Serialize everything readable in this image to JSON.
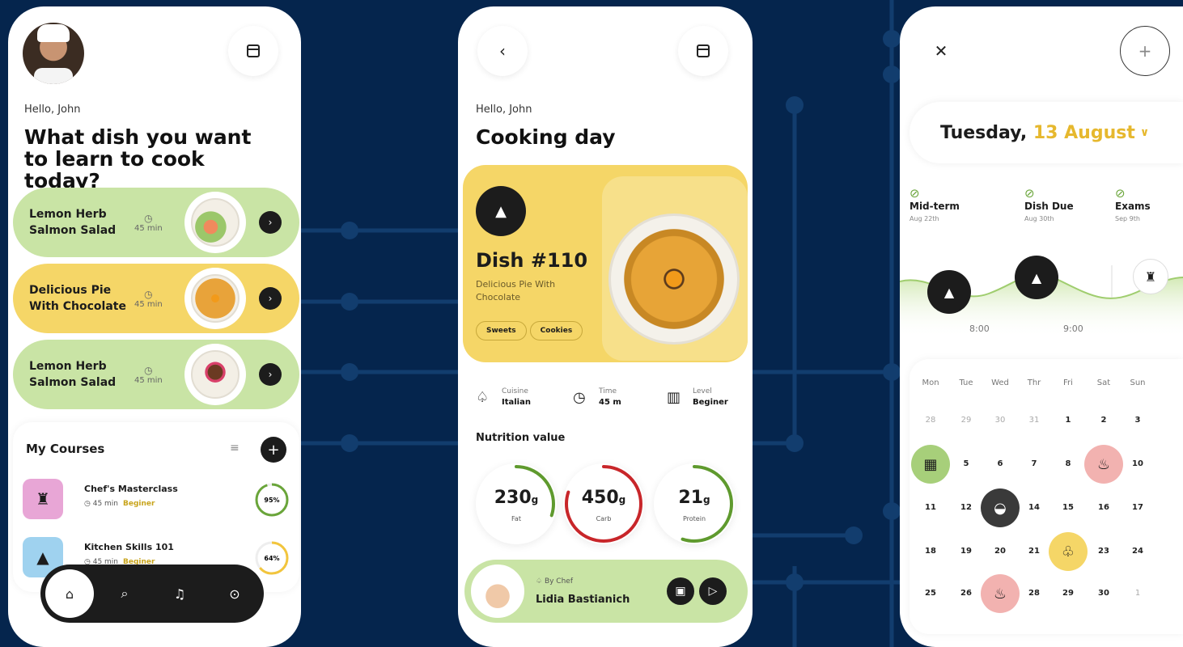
{
  "colors": {
    "background": "#05254d",
    "green": "#c9e4a5",
    "yellow": "#f5d667",
    "pink": "#f2b2b0",
    "dark": "#1c1c1c",
    "accent_text": "#c8a41c"
  },
  "screen1": {
    "greeting": "Hello, John",
    "headline": "What dish you want to learn to cook today?",
    "dishes": [
      {
        "name": "Lemon Herb Salmon Salad",
        "time": "45 min",
        "color": "green"
      },
      {
        "name": "Delicious Pie With Chocolate",
        "time": "45 min",
        "color": "yellow"
      },
      {
        "name": "Lemon Herb Salmon Salad",
        "time": "45 min",
        "color": "green"
      }
    ],
    "courses": {
      "title": "My Courses",
      "items": [
        {
          "title": "Chef's Masterclass",
          "time": "45 min",
          "level": "Beginer",
          "progress_label": "95%",
          "progress": 0.95,
          "icon": "chef-hat-icon"
        },
        {
          "title": "Kitchen Skills 101",
          "time": "45 min",
          "level": "Beginer",
          "progress_label": "64%",
          "progress": 0.64,
          "icon": "cloche-icon"
        }
      ]
    },
    "tabs": [
      "home-icon",
      "search-icon",
      "bell-icon",
      "settings-icon"
    ]
  },
  "screen2": {
    "greeting": "Hello, John",
    "title": "Cooking day",
    "dish": {
      "number": "Dish #110",
      "name": "Delicious Pie With Chocolate",
      "tags": [
        "Sweets",
        "Cookies"
      ]
    },
    "info": [
      {
        "label": "Cuisine",
        "value": "Italian",
        "icon": "cloche-outline-icon"
      },
      {
        "label": "Time",
        "value": "45 m",
        "icon": "clock-icon"
      },
      {
        "label": "Level",
        "value": "Beginer",
        "icon": "bars-icon"
      }
    ],
    "nutrition_title": "Nutrition value",
    "nutrition": [
      {
        "value": "230",
        "unit": "g",
        "label": "Fat",
        "progress": 0.3,
        "color": "#5f9a2e"
      },
      {
        "value": "450",
        "unit": "g",
        "label": "Carb",
        "progress": 0.8,
        "color": "#c8262a"
      },
      {
        "value": "21",
        "unit": "g",
        "label": "Protein",
        "progress": 0.55,
        "color": "#5f9a2e"
      }
    ],
    "chef": {
      "by": "By Chef",
      "name": "Lidia Bastianich"
    }
  },
  "screen3": {
    "date_day": "Tuesday,",
    "date_rest": "13 August",
    "events": [
      {
        "name": "Mid-term",
        "date": "Aug 22th"
      },
      {
        "name": "Dish Due",
        "date": "Aug 30th"
      },
      {
        "name": "Exams",
        "date": "Sep 9th"
      }
    ],
    "times": [
      "8:00",
      "9:00"
    ],
    "weekdays": [
      "Mon",
      "Tue",
      "Wed",
      "Thr",
      "Fri",
      "Sat",
      "Sun"
    ],
    "weeks": [
      [
        "28",
        "29",
        "30",
        "31",
        "1",
        "2",
        "3"
      ],
      [
        "",
        "5",
        "6",
        "7",
        "8",
        "",
        "10"
      ],
      [
        "11",
        "12",
        "",
        "14",
        "15",
        "16",
        "17"
      ],
      [
        "18",
        "19",
        "20",
        "21",
        "",
        "23",
        "24"
      ],
      [
        "25",
        "26",
        "",
        "28",
        "29",
        "30",
        "1"
      ]
    ]
  }
}
